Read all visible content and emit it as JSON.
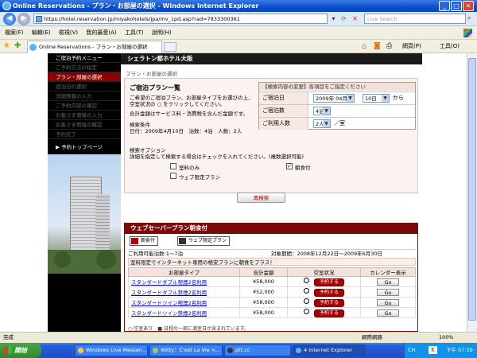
{
  "window": {
    "title": "Online Reservations - プラン・お部屋の選択 - Windows Internet Explorer",
    "min": "_",
    "max": "□",
    "close": "✕"
  },
  "address": {
    "url": "https://hotel.reservation.jp/miyakohotels/jpa/mv_1pd.asp?rad=7833300361",
    "search_placeholder": "Live Search"
  },
  "menu": [
    "檔案(F)",
    "編輯(E)",
    "檢視(V)",
    "我的最愛(A)",
    "工具(T)",
    "說明(H)"
  ],
  "tab": {
    "title": "Online Reservations - プラン・お部屋の選択"
  },
  "toolbar": {
    "page": "網頁(P)",
    "tools": "工具(O)"
  },
  "sidebar": {
    "items": [
      {
        "label": "ご宿泊予約メニュー"
      },
      {
        "label": "ご予約方法の指定"
      },
      {
        "label": "プラン・部屋の選択"
      },
      {
        "label": "宿泊日の選択"
      },
      {
        "label": "詳細情報の入力"
      },
      {
        "label": "ご予約内容の確認"
      },
      {
        "label": "お客さま情報の入力"
      },
      {
        "label": "お客さま情報の確認"
      },
      {
        "label": "予約完了"
      },
      {
        "label": "▶ 予約トップページ"
      }
    ]
  },
  "main": {
    "hotel_name": "シェラトン都ホテル大阪",
    "breadcrumb": "プラン・お部屋の選択",
    "plan_list_title": "ご宿泊プラン一覧",
    "desc1": "ご希望のご宿泊プラン、お部屋タイプをお選びの上、",
    "desc2": "空室状況の ○ をクリックしてください。",
    "desc3": "合計金額はサービス料・消費税を含んだ金額です。",
    "cond_label": "検索条件",
    "cond_value": "日付：2009年4月10日　泊数：4泊　人数：2人",
    "options_label": "検索オプション",
    "options_desc": "詳細を指定して検索する場合はチェックを入れてください。(複数選択可能)",
    "opt_room_only": "室料のみ",
    "opt_breakfast": "朝食付",
    "opt_web_only": "ウェブ限定プラン",
    "research_button": "再検索"
  },
  "search_panel": {
    "header": "【検索内容の変更】各項目をご指定ください",
    "date_label": "ご宿泊日",
    "month_value": "2009年 04月",
    "day_value": "10日",
    "day_suffix": "から",
    "nights_label": "ご宿泊数",
    "nights_value": "4泊",
    "guests_label": "ご利用人数",
    "guests_value": "2人",
    "guests_suffix": "／室"
  },
  "plan": {
    "title": "ウェブセーバープラン朝食付",
    "badge_breakfast": "朝食付",
    "badge_web": "ウェブ限定プラン",
    "usage": "ご利用可能泊数:1〜7泊",
    "period": "対象期間：2008年12月22日〜2009年6月30日",
    "notice": "室料限定でインターネット専用の格安プランに朝食をプラス！",
    "columns": [
      "お部屋タイプ",
      "合計金額",
      "空室状況",
      "カレンダー表示"
    ],
    "rows": [
      {
        "name": "スタンダードダブル喫煙2名利用",
        "price": "¥58,000"
      },
      {
        "name": "スタンダードダブル禁煙2名利用",
        "price": "¥52,000"
      },
      {
        "name": "スタンダードツイン喫煙2名利用",
        "price": "¥58,000"
      },
      {
        "name": "スタンダードツイン禁煙2名利用",
        "price": "¥58,000"
      }
    ],
    "reserve_label": "予約する",
    "go_label": "Go",
    "footnote": "○:空室あり　■:日程の一部に満室日が含まれています。"
  },
  "status": {
    "left": "完成",
    "zone": "網際網路",
    "zoom": "100%"
  },
  "taskbar": {
    "start": "開始",
    "tasks": [
      "Windows Live Messen...",
      "Witty：C'est La Vie <...",
      "ptt.cc",
      "4 Internet Explorer"
    ],
    "lang": "CH",
    "clock": "下午 07:39"
  }
}
